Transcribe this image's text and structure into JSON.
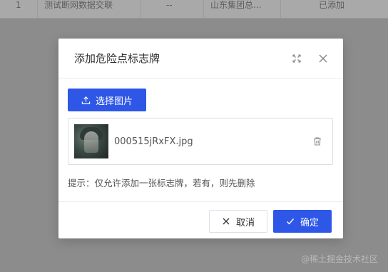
{
  "background_table": {
    "row_index": "1",
    "cell_name": "测试断网数据交联",
    "cell_dash": "--",
    "cell_location": "山东集团总...",
    "cell_status": "已添加"
  },
  "dialog": {
    "title": "添加危险点标志牌",
    "upload_label": "选择图片",
    "file": {
      "name": "000515jRxFX.jpg"
    },
    "hint": "提示：仅允许添加一张标志牌，若有，则先删除",
    "cancel_label": "取消",
    "confirm_label": "确定"
  },
  "watermark": "@稀土掘金技术社区",
  "colors": {
    "primary": "#2e57e8",
    "overlay": "#8c8c8c"
  },
  "icons": {
    "maximize": "maximize-icon",
    "close": "close-icon",
    "upload": "upload-icon",
    "delete": "trash-icon",
    "cancel": "x-icon",
    "confirm": "check-icon"
  }
}
